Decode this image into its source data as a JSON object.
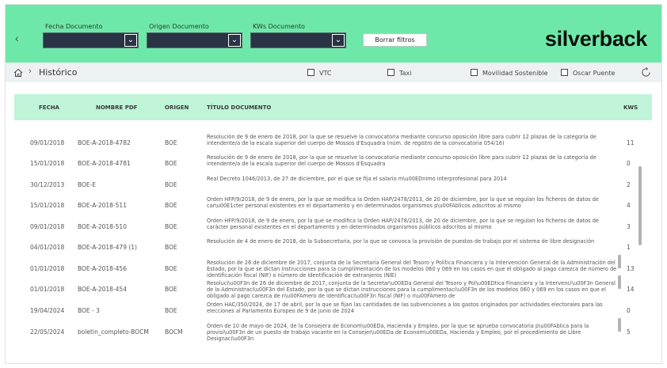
{
  "filters": {
    "fecha_label": "Fecha Documento",
    "origen_label": "Origen Documento",
    "kws_label": "KWs Documento",
    "clear_label": "Borrar filtros"
  },
  "brand": "silverback",
  "breadcrumb": {
    "title": "Histórico"
  },
  "categories": [
    "VTC",
    "Taxi",
    "Movilidad Sostenible",
    "Oscar Puente"
  ],
  "table": {
    "headers": {
      "fecha": "FECHA",
      "nombre": "NOMBRE PDF",
      "origen": "ORIGEN",
      "titulo": "TÍTULO DOCUMENTO",
      "kws": "KWS"
    },
    "rows": [
      {
        "fecha": "09/01/2018",
        "nombre": "BOE-A-2018-4782",
        "origen": "BOE",
        "titulo": "Resolución de 9 de enero de 2018, por la que se resuelve la convocatoria mediante concurso oposición libre para cubrir 12 plazas de la categoría de intendente/a de la escala superior del cuerpo de Mossos d'Esquadra (núm. de registro de la convocatoria 054/16)",
        "kws": "11"
      },
      {
        "fecha": "15/01/2018",
        "nombre": "BOE-A-2018-4781",
        "origen": "BOE",
        "titulo": "Resolución de 9 de enero de 2018, por la que se resuelve la convocatoria mediante concurso oposición libre para cubrir 12 plazas de la categoría de intendente/a de la escala superior del cuerpo de Mossos d'Esquadra",
        "kws": "0"
      },
      {
        "fecha": "30/12/2013",
        "nombre": "BOE-E",
        "origen": "BOE",
        "titulo": "Real Decreto 1046/2013, de 27 de diciembre, por el que se fija el salario m\\u00EDnimo interprofesional para 2014",
        "kws": "2"
      },
      {
        "fecha": "15/01/2018",
        "nombre": "BOE-A-2018-511",
        "origen": "BOE",
        "titulo": "Orden HFP/9/2018, de 9 de enero, por la que se modifica la Orden HAP/2478/2013, de 20 de diciembre, por la que se regulan los ficheros de datos de car\\u00E1cter personal existentes en el departamento y en determinados organismos p\\u00FAblicos adscritos al mismo",
        "kws": "4"
      },
      {
        "fecha": "09/01/2018",
        "nombre": "BOE-A-2018-510",
        "origen": "BOE",
        "titulo": "Orden HFP/9/2018, de 9 de enero, por la que se modifica la Orden HAP/2478/2013, de 20 de diciembre, por la que se regulan los ficheros de datos de carácter personal existentes en el departamento y en determinados organismos públicos adscritos al mismo",
        "kws": "3"
      },
      {
        "fecha": "04/01/2018",
        "nombre": "BOE-A-2018-479 (1)",
        "origen": "BOE",
        "titulo": "Resolución de 4 de enero de 2018, de la Subsecretaría, por la que se convoca la provisión de puestos de trabajo por el sistema de libre designación",
        "kws": "1"
      },
      {
        "fecha": "01/01/2018",
        "nombre": "BOE-A-2018-456",
        "origen": "BOE",
        "titulo": "Resolución de 26 de diciembre de 2017, conjunta de la Secretaría General del Tesoro y Política Financiera y la Intervención General de la Administración del Estado, por la que se dictan instrucciones para la cumplimentación de los modelos 060 y 069 en los casos en que el obligado al pago carezca de número de identificación fiscal (NIF) o número de identificación de extranjeros (NIE)",
        "kws": "13"
      },
      {
        "fecha": "01/01/2018",
        "nombre": "BOE-A-2018-454",
        "origen": "BOE",
        "titulo": "Resoluci\\u00F3n de 26 de diciembre de 2017, conjunta de la Secretar\\u00EDa General del Tesoro y Pol\\u00EDtica Financiera y la Intervenci\\u00F3n General de la Administraci\\u00F3n del Estado, por la que se dictan instrucciones para la cumplimentaci\\u00F3n de los modelos 060 y 069 en los casos en que el obligado al pago carezca de n\\u00FAmero de identificaci\\u00F3n fiscal (NIF) o n\\u00FAmero de",
        "kws": "14"
      },
      {
        "fecha": "19/04/2024",
        "nombre": "BOE - 3",
        "origen": "BOE",
        "titulo": "Orden HAC/350/2024, de 17 de abril, por la que se fijan las cantidades de las subvenciones a los gastos originados por actividades electorales para las elecciones al Parlamento Europeo de 9 de junio de 2024",
        "kws": "0"
      },
      {
        "fecha": "22/05/2024",
        "nombre": "boletin_completo-BOCM",
        "origen": "BOCM",
        "titulo": "Orden de 10 de mayo de 2024, de la Consejera de Econom\\u00EDa, Hacienda y Empleo, por la que se aprueba convocatoria p\\u00FAblica para la provisi\\u00F3n de un puesto de trabajo vacante en la Consejer\\u00EDa de Econom\\u00EDa, Hacienda y Empleo, por el procedimiento de Libre Designaci\\u00F3n",
        "kws": "5"
      }
    ]
  }
}
